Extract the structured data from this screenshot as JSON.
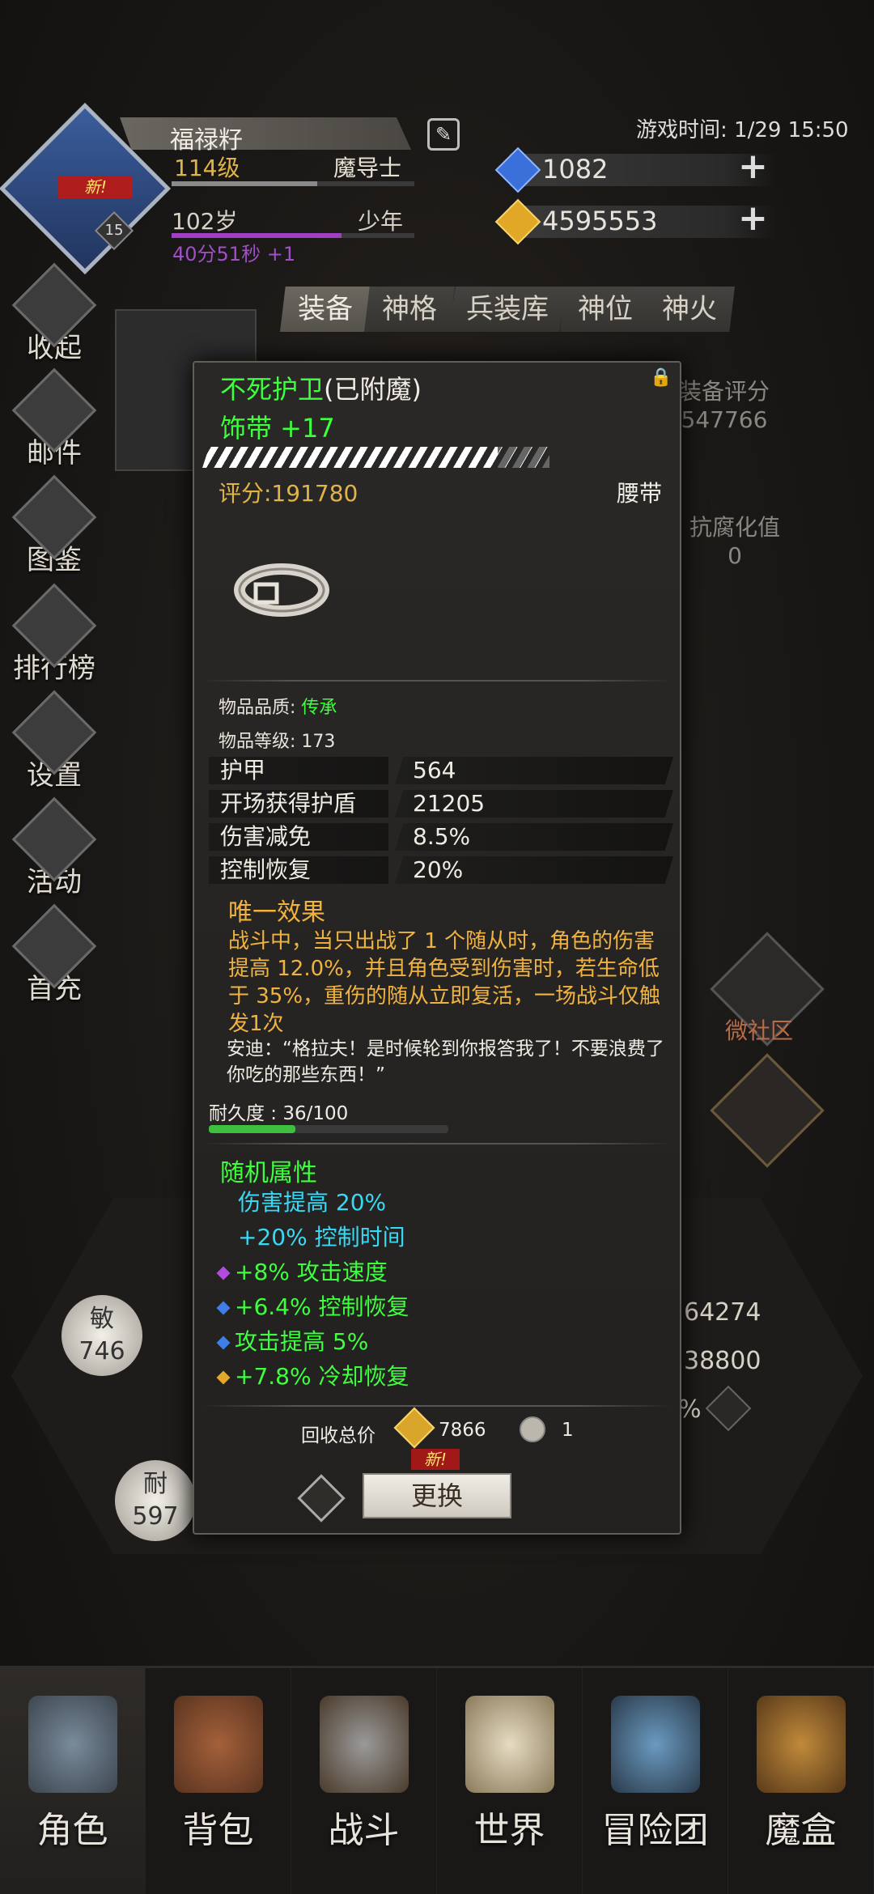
{
  "player": {
    "name": "福禄籽",
    "level": "114级",
    "class": "魔导士",
    "age": "102岁",
    "stage": "少年",
    "age_timer": "40分51秒 +1",
    "badge_level": "15",
    "new_tag": "新!"
  },
  "game_time": "游戏时间: 1/29 15:50",
  "currency": [
    {
      "name": "blue-gem",
      "value": "1082",
      "color": "#3b6fd9"
    },
    {
      "name": "gold-gem",
      "value": "4595553",
      "color": "#e0a826"
    }
  ],
  "sidebar": [
    {
      "label": "收起",
      "icon": "collapse-icon"
    },
    {
      "label": "邮件",
      "icon": "mail-icon"
    },
    {
      "label": "图鉴",
      "icon": "book-icon"
    },
    {
      "label": "排行榜",
      "icon": "ranking-icon"
    },
    {
      "label": "设置",
      "icon": "gear-icon"
    },
    {
      "label": "活动",
      "icon": "event-icon"
    },
    {
      "label": "首充",
      "icon": "first-charge-icon"
    }
  ],
  "tabs": [
    "装备",
    "神格",
    "兵装库",
    "神位",
    "神火"
  ],
  "back_panel": {
    "gear_score_label": "装备评分",
    "gear_score": "547766",
    "anti_corruption_label": "抗腐化值",
    "anti_corruption": "0",
    "stat_right_1": "64274",
    "stat_right_2": "38800",
    "stat_right_3": "%",
    "agi_label": "敏",
    "agi_value": "746",
    "dur_label": "耐",
    "dur_value": "597",
    "social": "微社区"
  },
  "item": {
    "name": "不死护卫",
    "suffix": "(已附魔)",
    "type": "饰带 +17",
    "score": "评分:191780",
    "slot": "腰带",
    "quality_label": "物品品质: ",
    "quality": "传承",
    "level": "物品等级: 173",
    "stats": [
      {
        "k": "护甲",
        "v": "564"
      },
      {
        "k": "开场获得护盾",
        "v": "21205"
      },
      {
        "k": "伤害减免",
        "v": "8.5%"
      },
      {
        "k": "控制恢复",
        "v": "20%"
      }
    ],
    "unique_title": "唯一效果",
    "unique_desc": "战斗中，当只出战了 1 个随从时，角色的伤害提高 12.0%，并且角色受到伤害时，若生命低于 35%，重伤的随从立即复活，一场战斗仅触发1次",
    "quote": "安迪：“格拉夫！是时候轮到你报答我了！不要浪费了你吃的那些东西！”",
    "durability": "耐久度 : 36/100",
    "durability_fraction": 0.36,
    "random_title": "随机属性",
    "random": [
      {
        "text": "伤害提高 20%",
        "color": "cyan",
        "gem": ""
      },
      {
        "text": "+20% 控制时间",
        "color": "cyan",
        "gem": ""
      },
      {
        "text": "+8% 攻击速度",
        "color": "green",
        "gem": "#b24be0"
      },
      {
        "text": "+6.4% 控制恢复",
        "color": "green",
        "gem": "#3f7de8"
      },
      {
        "text": "攻击提高 5%",
        "color": "green",
        "gem": "#3f7de8"
      },
      {
        "text": "+7.8% 冷却恢复",
        "color": "green",
        "gem": "#e3a82a"
      }
    ],
    "recycle_label": "回收总价",
    "recycle_gold": "7866",
    "recycle_shard": "1",
    "new_badge": "新!",
    "swap_label": "更换"
  },
  "nav": [
    {
      "label": "角色",
      "icon": "helmet-icon",
      "active": true
    },
    {
      "label": "背包",
      "icon": "backpack-icon"
    },
    {
      "label": "战斗",
      "icon": "sword-shield-icon"
    },
    {
      "label": "世界",
      "icon": "scroll-map-icon"
    },
    {
      "label": "冒险团",
      "icon": "castle-icon"
    },
    {
      "label": "魔盒",
      "icon": "magic-box-icon"
    }
  ]
}
